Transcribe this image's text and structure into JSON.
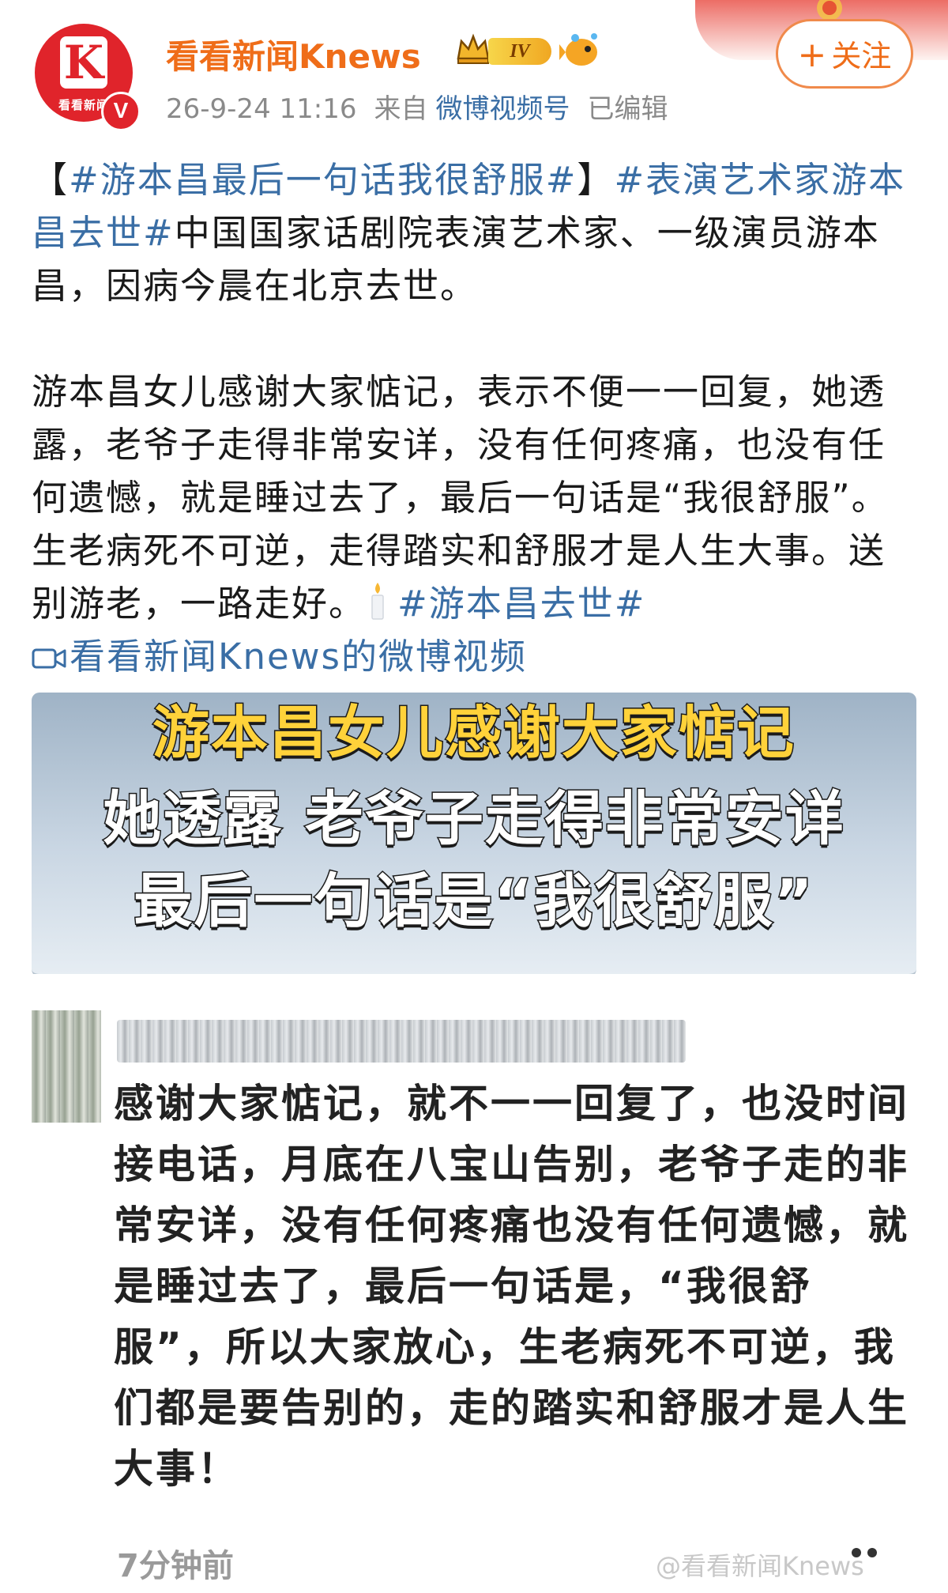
{
  "header": {
    "avatar_text": "看看新闻",
    "avatar_logo": "K",
    "verify_mark": "V",
    "username": "看看新闻Knews",
    "level_badge": "IV",
    "timestamp": "26-9-24 11:16",
    "source_prefix": "来自",
    "source_name": "微博视频号",
    "edited_label": "已编辑",
    "follow_plus": "+",
    "follow_label": "关注",
    "icons": [
      "crown-icon",
      "level-badge",
      "fish-icon",
      "emblem-icon",
      "verified-icon"
    ]
  },
  "post": {
    "line1_bracket_open": "【",
    "tag1": "#游本昌最后一句话我很舒服#",
    "line1_bracket_close": "】",
    "tag2": "#表演艺术家游本昌去世#",
    "text1": "中国国家话剧院表演艺术家、一级演员游本昌，因病今晨在北京去世。",
    "text2": "游本昌女儿感谢大家惦记，表示不便一一回复，她透露，老爷子走得非常安详，没有任何疼痛，也没有任何遗憾，就是睡过去了，最后一句话是“我很舒服”。生老病死不可逆，走得踏实和舒服才是人生大事。送别游老，一路走好。",
    "tag3": "#游本昌去世#",
    "video_link": "看看新闻Knews的微博视频"
  },
  "video_thumbnail": {
    "line1": "游本昌女儿感谢大家惦记",
    "line2": "她透露  老爷子走得非常安详",
    "line3": "最后一句话是“我很舒服”"
  },
  "comment_screenshot": {
    "text": "感谢大家惦记，就不一一回复了，也没时间接电话，月底在八宝山告别，老爷子走的非常安详，没有任何疼痛也没有任何遗憾，就是睡过去了，最后一句话是，“我很舒服”，所以大家放心，生老病死不可逆，我们都是要告别的，走的踏实和舒服才是人生大事！",
    "time": "7分钟前",
    "watermark": "@看看新闻Knews"
  },
  "colors": {
    "username": "#ef6d19",
    "link": "#3a6ea5",
    "brand_red": "#e0242b",
    "meta_gray": "#8a8a8a"
  }
}
